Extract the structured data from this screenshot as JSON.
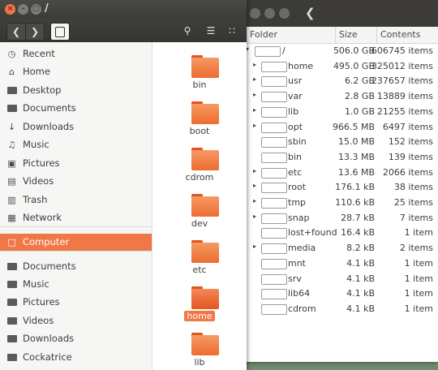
{
  "nautilus": {
    "title": "/",
    "sidebar": [
      {
        "label": "Recent",
        "icon": "clock-icon"
      },
      {
        "label": "Home",
        "icon": "home-icon"
      },
      {
        "label": "Desktop",
        "icon": "folder-icon"
      },
      {
        "label": "Documents",
        "icon": "folder-icon"
      },
      {
        "label": "Downloads",
        "icon": "download-icon"
      },
      {
        "label": "Music",
        "icon": "music-icon"
      },
      {
        "label": "Pictures",
        "icon": "camera-icon"
      },
      {
        "label": "Videos",
        "icon": "video-icon"
      },
      {
        "label": "Trash",
        "icon": "trash-icon"
      },
      {
        "label": "Network",
        "icon": "network-icon"
      },
      {
        "label": "Computer",
        "icon": "drive-icon",
        "selected": true
      },
      {
        "label": "Documents",
        "icon": "folder-icon"
      },
      {
        "label": "Music",
        "icon": "folder-icon"
      },
      {
        "label": "Pictures",
        "icon": "folder-icon"
      },
      {
        "label": "Videos",
        "icon": "folder-icon"
      },
      {
        "label": "Downloads",
        "icon": "folder-icon"
      },
      {
        "label": "Cockatrice",
        "icon": "folder-icon"
      }
    ],
    "files": [
      {
        "name": "bin"
      },
      {
        "name": "boot"
      },
      {
        "name": "cdrom"
      },
      {
        "name": "dev"
      },
      {
        "name": "etc"
      },
      {
        "name": "home",
        "selected": true
      },
      {
        "name": "lib"
      }
    ]
  },
  "baobab": {
    "headers": {
      "folder": "Folder",
      "size": "Size",
      "contents": "Contents"
    },
    "rows": [
      {
        "name": "/",
        "size": "506.0 GB",
        "contents": "606745 items",
        "expander": "open",
        "root": true
      },
      {
        "name": "home",
        "size": "495.0 GB",
        "contents": "325012 items",
        "expander": "closed"
      },
      {
        "name": "usr",
        "size": "6.2 GB",
        "contents": "237657 items",
        "expander": "closed"
      },
      {
        "name": "var",
        "size": "2.8 GB",
        "contents": "13889 items",
        "expander": "closed"
      },
      {
        "name": "lib",
        "size": "1.0 GB",
        "contents": "21255 items",
        "expander": "closed"
      },
      {
        "name": "opt",
        "size": "966.5 MB",
        "contents": "6497 items",
        "expander": "closed"
      },
      {
        "name": "sbin",
        "size": "15.0 MB",
        "contents": "152 items",
        "expander": ""
      },
      {
        "name": "bin",
        "size": "13.3 MB",
        "contents": "139 items",
        "expander": ""
      },
      {
        "name": "etc",
        "size": "13.6 MB",
        "contents": "2066 items",
        "expander": "closed"
      },
      {
        "name": "root",
        "size": "176.1 kB",
        "contents": "38 items",
        "expander": "closed"
      },
      {
        "name": "tmp",
        "size": "110.6 kB",
        "contents": "25 items",
        "expander": "closed"
      },
      {
        "name": "snap",
        "size": "28.7 kB",
        "contents": "7 items",
        "expander": "closed"
      },
      {
        "name": "lost+found",
        "size": "16.4 kB",
        "contents": "1 item",
        "expander": ""
      },
      {
        "name": "media",
        "size": "8.2 kB",
        "contents": "2 items",
        "expander": "closed"
      },
      {
        "name": "mnt",
        "size": "4.1 kB",
        "contents": "1 item",
        "expander": ""
      },
      {
        "name": "srv",
        "size": "4.1 kB",
        "contents": "1 item",
        "expander": ""
      },
      {
        "name": "lib64",
        "size": "4.1 kB",
        "contents": "1 item",
        "expander": ""
      },
      {
        "name": "cdrom",
        "size": "4.1 kB",
        "contents": "1 item",
        "expander": ""
      }
    ]
  },
  "colors": {
    "accent": "#f07746",
    "titlebar": "#3c3b37"
  }
}
